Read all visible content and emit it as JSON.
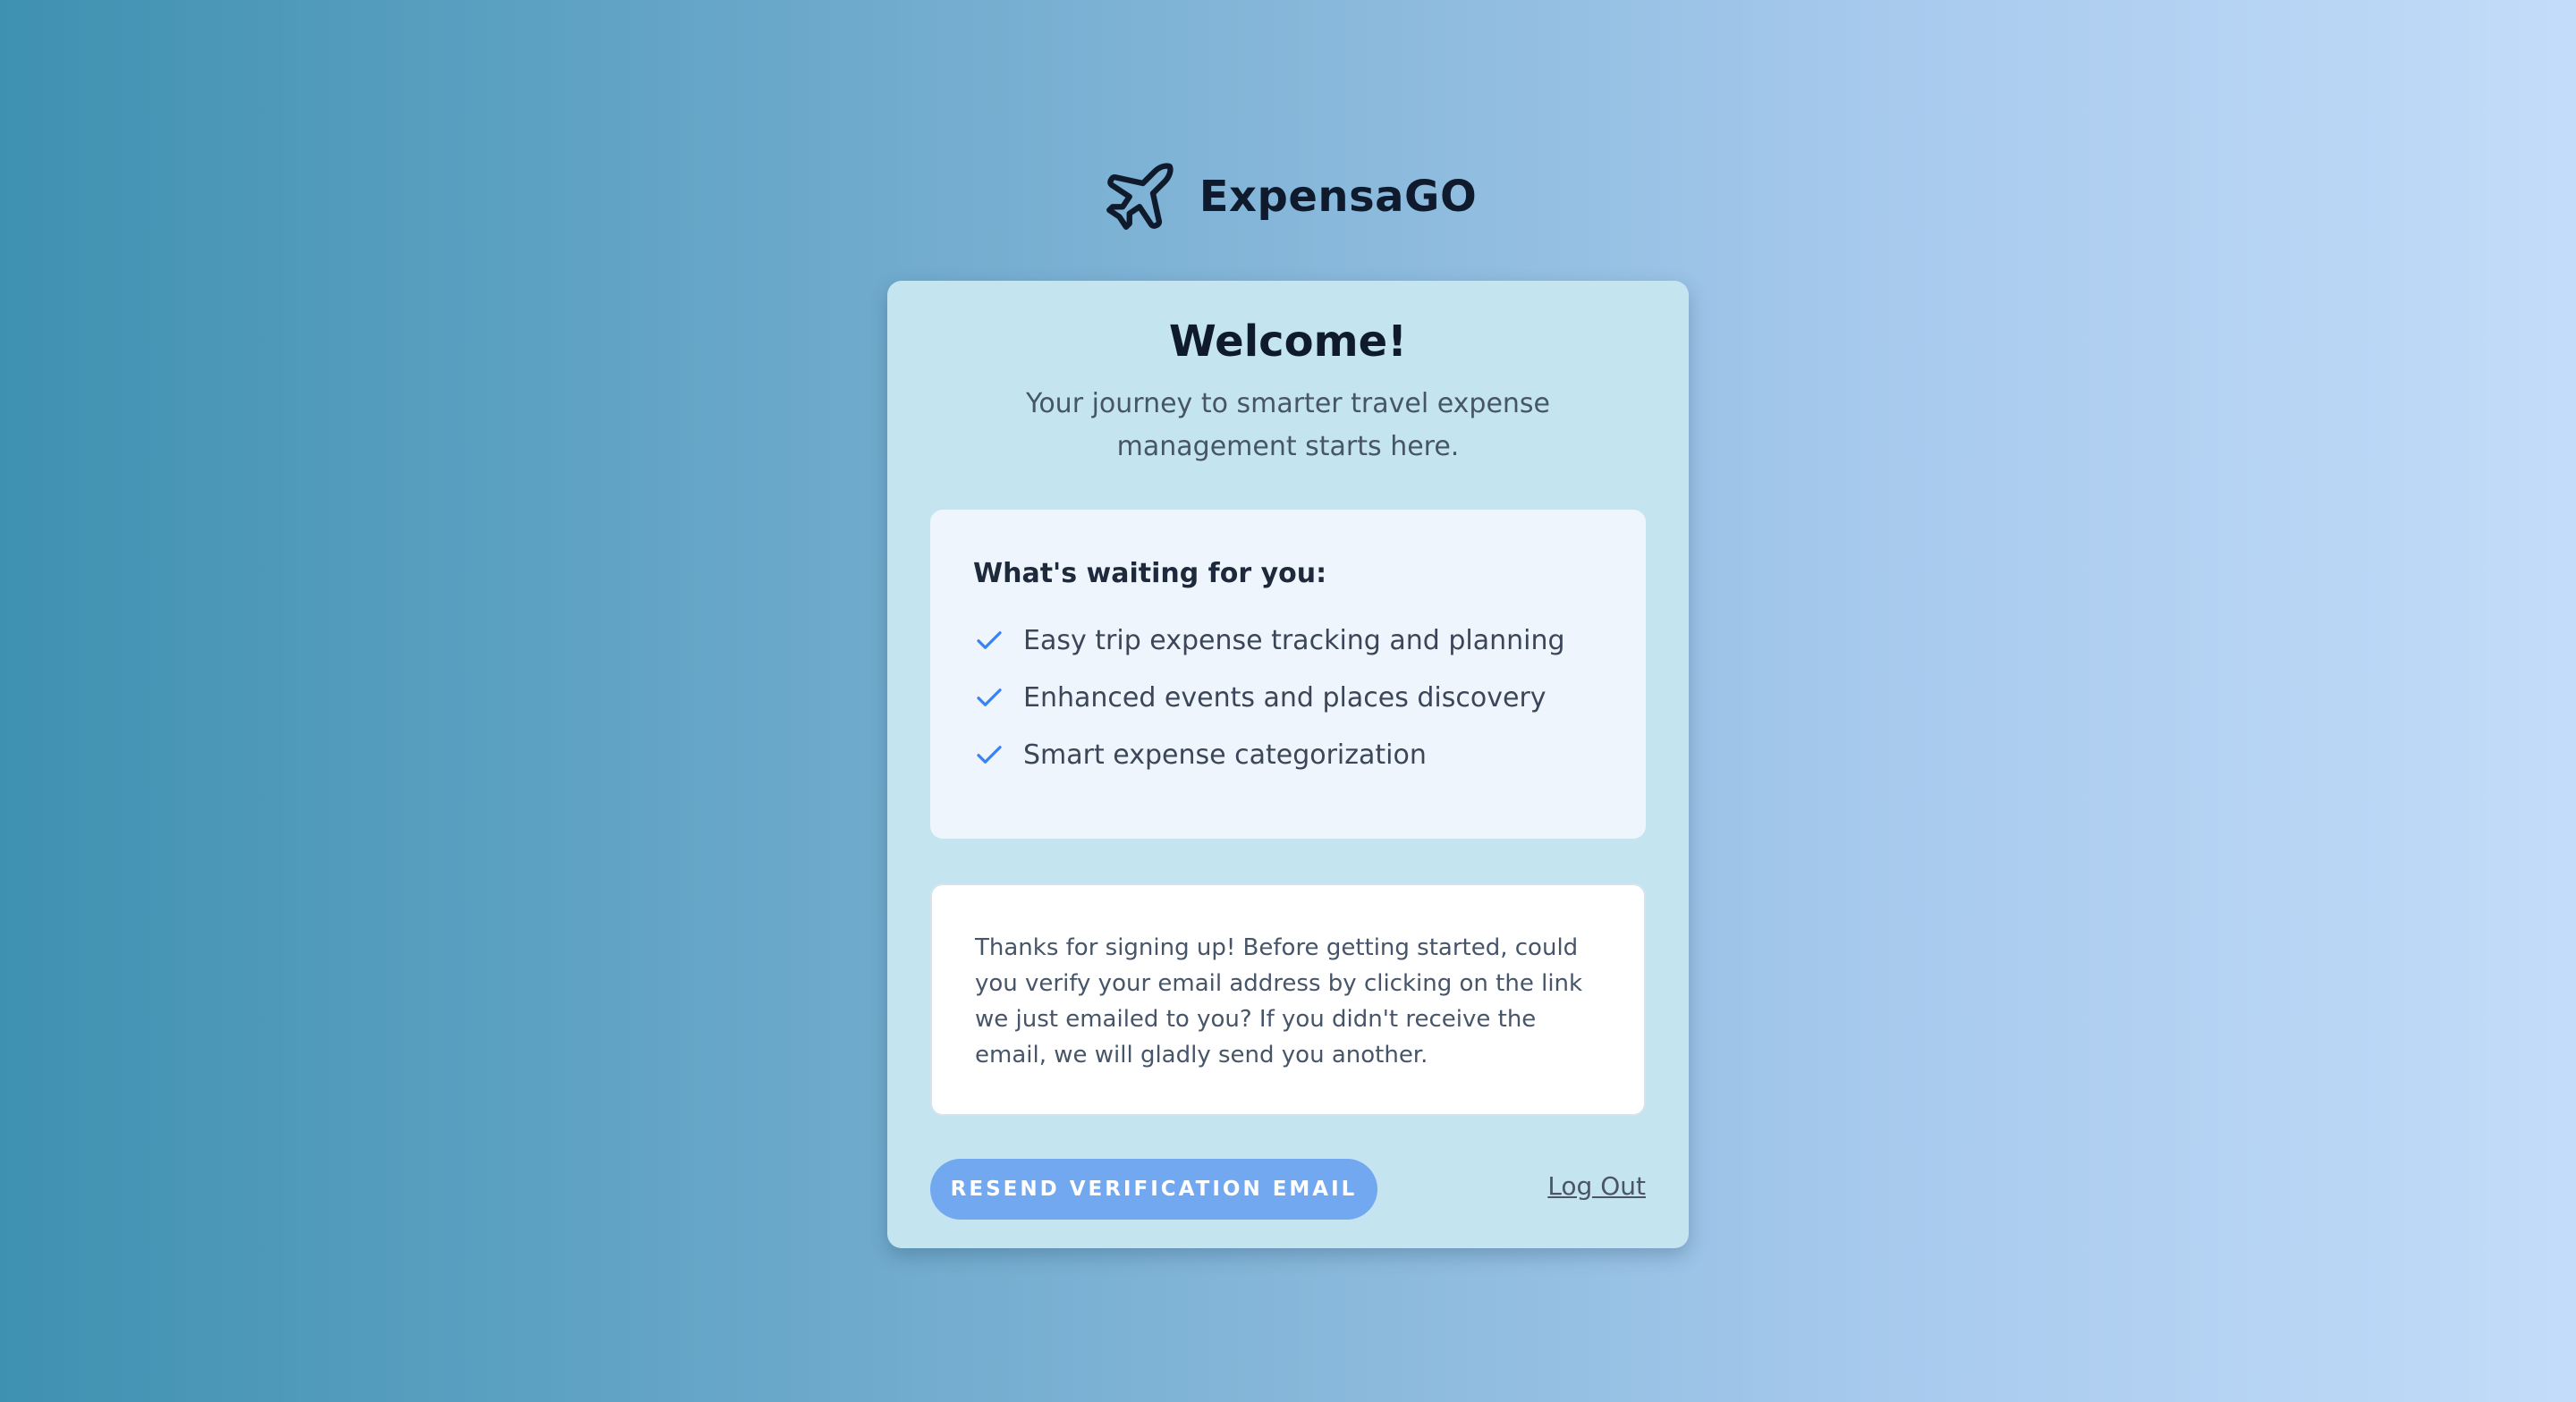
{
  "brand": {
    "name": "ExpensaGO",
    "icon": "airplane-icon"
  },
  "card": {
    "title": "Welcome!",
    "subtitle": "Your journey to smarter travel expense management starts here."
  },
  "features": {
    "heading": "What's waiting for you:",
    "items": [
      {
        "label": "Easy trip expense tracking and planning",
        "icon": "check-icon"
      },
      {
        "label": "Enhanced events and places discovery",
        "icon": "check-icon"
      },
      {
        "label": "Smart expense categorization",
        "icon": "check-icon"
      }
    ]
  },
  "notice": {
    "text": "Thanks for signing up! Before getting started, could you verify your email address by clicking on the link we just emailed to you? If you didn't receive the email, we will gladly send you another."
  },
  "actions": {
    "resend_label": "RESEND VERIFICATION EMAIL",
    "logout_label": "Log Out"
  },
  "colors": {
    "accent": "#72a8ef",
    "check": "#3b82f6",
    "card_bg": "#c4e5f0",
    "heading": "#0f1b2d"
  }
}
